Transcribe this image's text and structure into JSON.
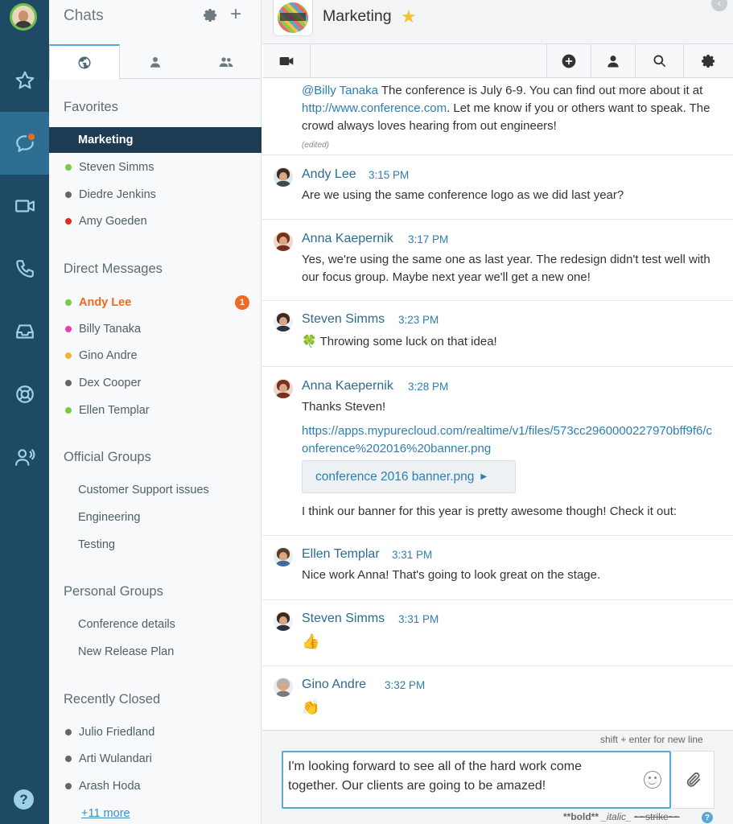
{
  "app": {
    "accent": "#f26a21",
    "rail_color": "#1f4a66",
    "link_color": "#2d7fb3"
  },
  "rail": {
    "items": [
      {
        "name": "star-icon"
      },
      {
        "name": "chat-bubble-icon",
        "active": true
      },
      {
        "name": "video-camera-icon"
      },
      {
        "name": "phone-icon"
      },
      {
        "name": "inbox-icon"
      },
      {
        "name": "lifebuoy-icon"
      },
      {
        "name": "user-voice-icon"
      }
    ],
    "help_label": "?"
  },
  "sidebar": {
    "title": "Chats",
    "plus_label": "+",
    "favorites": {
      "title": "Favorites",
      "items": [
        {
          "label": "Marketing",
          "selected": true
        },
        {
          "label": "Steven Simms",
          "status": "#7ac943"
        },
        {
          "label": "Diedre Jenkins",
          "status": "#666666"
        },
        {
          "label": "Amy Goeden",
          "status": "#e02b20"
        }
      ]
    },
    "direct": {
      "title": "Direct Messages",
      "items": [
        {
          "label": "Andy Lee",
          "status": "#7ac943",
          "unread": "1"
        },
        {
          "label": "Billy Tanaka",
          "status": "#e83eb6"
        },
        {
          "label": "Gino Andre",
          "status": "#f5b335"
        },
        {
          "label": "Dex Cooper",
          "status": "#666666"
        },
        {
          "label": "Ellen Templar",
          "status": "#7ac943"
        }
      ]
    },
    "official": {
      "title": "Official Groups",
      "items": [
        {
          "label": "Customer Support issues"
        },
        {
          "label": "Engineering"
        },
        {
          "label": "Testing"
        }
      ]
    },
    "personal": {
      "title": "Personal Groups",
      "items": [
        {
          "label": "Conference details"
        },
        {
          "label": "New Release Plan"
        }
      ]
    },
    "recent": {
      "title": "Recently Closed",
      "items": [
        {
          "label": "Julio Friedland",
          "status": "#666666"
        },
        {
          "label": "Arti Wulandari",
          "status": "#666666"
        },
        {
          "label": "Arash Hoda",
          "status": "#666666"
        }
      ],
      "more": "+11 more"
    }
  },
  "room": {
    "title": "Marketing",
    "star": "★",
    "close": "‹"
  },
  "messages": {
    "m0": {
      "mention": "@Billy Tanaka",
      "text1": " The conference is July 6-9. You can find out more about it at ",
      "link": "http://www.conference.com",
      "text2": ". Let me know if you or others want to speak. The crowd always loves hearing from out engineers!",
      "edited": "(edited)"
    },
    "m1": {
      "sender": "Andy Lee",
      "time": "3:15 PM",
      "text": "Are we using the same conference logo as we did last year?"
    },
    "m2": {
      "sender": "Anna Kaepernik",
      "time": "3:17 PM",
      "text": "Yes, we're using the same one as last year. The redesign didn't test well with our focus group. Maybe next year we'll get a new one!"
    },
    "m3": {
      "sender": "Steven Simms",
      "time": "3:23 PM",
      "emoji": "🍀",
      "text": " Throwing some luck on that idea!"
    },
    "m4": {
      "sender": "Anna Kaepernik",
      "time": "3:28 PM",
      "text": "Thanks Steven!",
      "link": "https://apps.mypurecloud.com/realtime/v1/files/573cc2960000227970bff9f6/conference%202016%20banner.png",
      "file": "conference 2016 banner.png",
      "caption": "I think our banner for this year is pretty awesome though! Check it out:"
    },
    "m5": {
      "sender": "Ellen Templar",
      "time": "3:31 PM",
      "text": "Nice work Anna! That's going to look great on the stage."
    },
    "m6": {
      "sender": "Steven Simms",
      "time": "3:31 PM",
      "emoji": "👍"
    },
    "m7": {
      "sender": "Gino Andre",
      "time": "3:32 PM",
      "emoji": "👏"
    }
  },
  "composer": {
    "hint": "shift + enter for new line",
    "value": "I'm looking forward to see all of the hard work come together. Our clients are going to be amazed!",
    "format_bold": "**bold**",
    "format_italic": "_italic_",
    "format_strike": "~~strike~~",
    "format_help": "?"
  }
}
